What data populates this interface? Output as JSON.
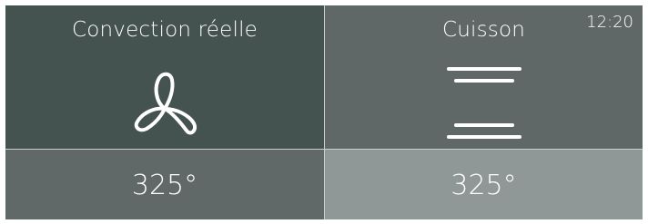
{
  "clock": {
    "time": "12:20"
  },
  "mode": {
    "label": "Convection réelle",
    "icon": "fan-icon"
  },
  "cooking": {
    "label": "Cuisson",
    "icon": "heating-elements-icon"
  },
  "temperatures": {
    "left": "325°",
    "right": "325°"
  },
  "colors": {
    "mode_tile": "#445250",
    "cook_tile": "#5f6867",
    "temp_left_tile": "#606967",
    "temp_right_tile": "#8f9897",
    "text": "#ffffff"
  }
}
